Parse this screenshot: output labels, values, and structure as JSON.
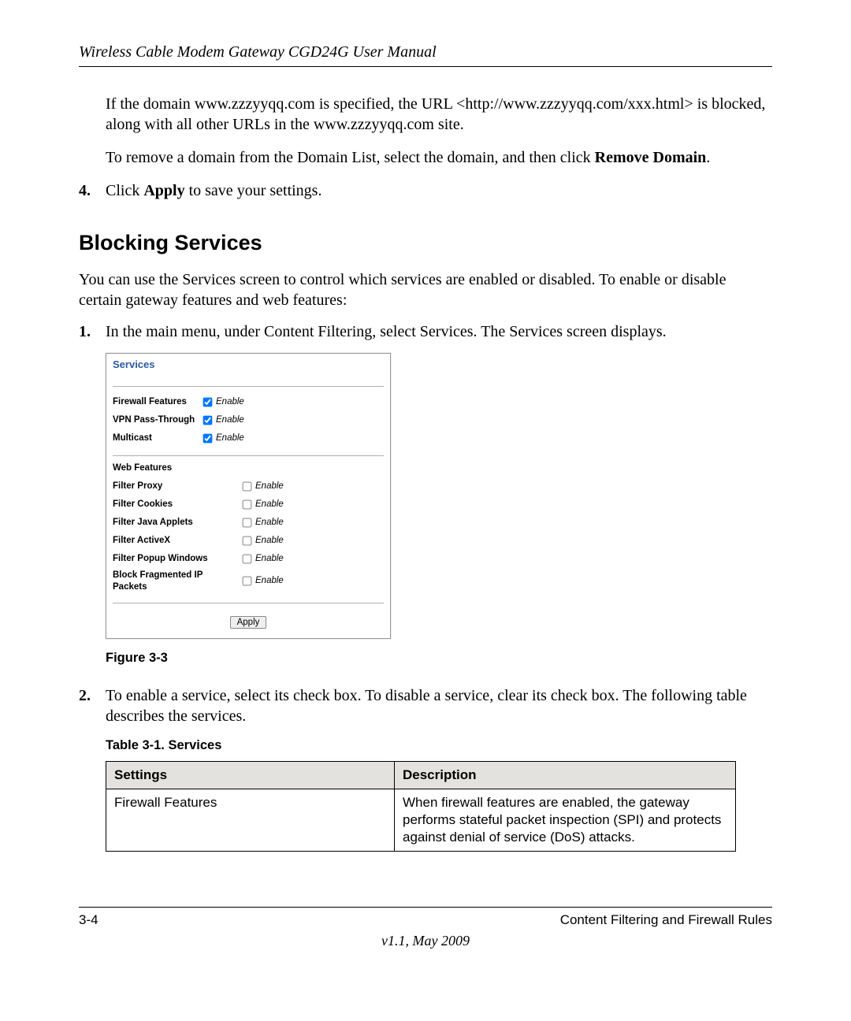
{
  "header": {
    "title": "Wireless Cable Modem Gateway CGD24G User Manual"
  },
  "para": {
    "domain_example": "If the domain www.zzzyyqq.com is specified, the URL <http://www.zzzyyqq.com/xxx.html> is blocked, along with all other URLs in the www.zzzyyqq.com site.",
    "remove_pre": "To remove a domain from the Domain List, select the domain, and then click ",
    "remove_bold": "Remove Domain",
    "remove_post": "."
  },
  "step4": {
    "num": "4.",
    "pre": "Click ",
    "bold": "Apply",
    "post": " to save your settings."
  },
  "heading": "Blocking Services",
  "intro": "You can use the Services screen to control which services are enabled or disabled. To enable or disable certain gateway features and web features:",
  "step1": {
    "num": "1.",
    "text": "In the main menu, under Content Filtering, select Services. The Services screen displays."
  },
  "screenshot": {
    "title": "Services",
    "enable_label": "Enable",
    "top_rows": [
      {
        "label": "Firewall Features",
        "checked": true
      },
      {
        "label": "VPN Pass-Through",
        "checked": true
      },
      {
        "label": "Multicast",
        "checked": true
      }
    ],
    "web_heading": "Web Features",
    "web_rows": [
      {
        "label": "Filter Proxy",
        "checked": false
      },
      {
        "label": "Filter Cookies",
        "checked": false
      },
      {
        "label": "Filter Java Applets",
        "checked": false
      },
      {
        "label": "Filter ActiveX",
        "checked": false
      },
      {
        "label": "Filter Popup Windows",
        "checked": false
      },
      {
        "label": "Block Fragmented IP Packets",
        "checked": false
      }
    ],
    "apply": "Apply"
  },
  "figure_caption": "Figure 3-3",
  "step2": {
    "num": "2.",
    "text": "To enable a service, select its check box. To disable a service, clear its check box. The following table describes the services."
  },
  "table": {
    "caption": "Table 3-1. Services",
    "headers": {
      "col1": "Settings",
      "col2": "Description"
    },
    "row1": {
      "c1": "Firewall Features",
      "c2": "When firewall features are enabled, the gateway performs stateful packet inspection (SPI) and protects against denial of service (DoS) attacks."
    }
  },
  "footer": {
    "page": "3-4",
    "section": "Content Filtering and Firewall Rules",
    "version": "v1.1, May 2009"
  }
}
